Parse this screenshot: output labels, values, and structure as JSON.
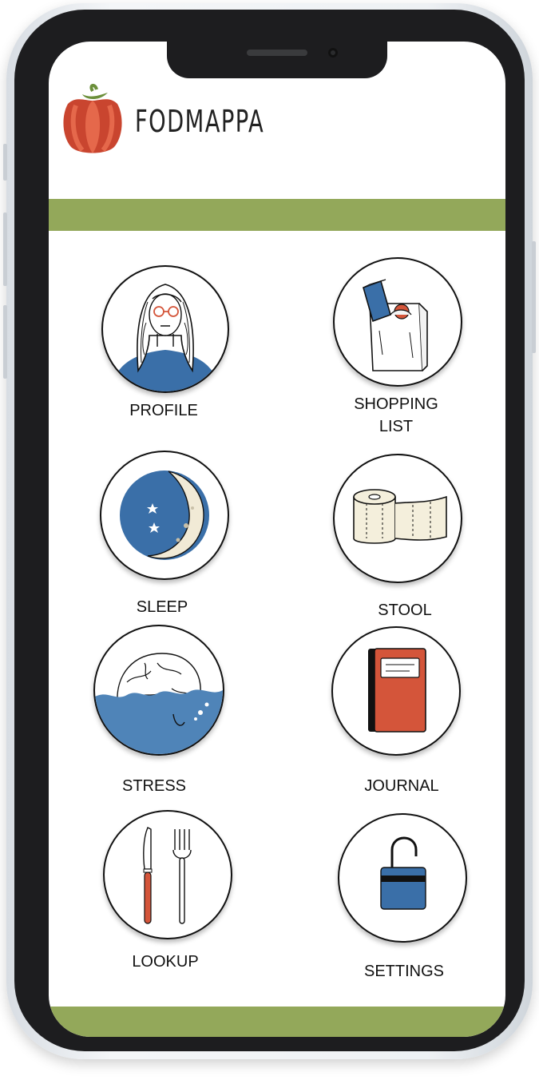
{
  "app": {
    "name": "FODMAPPA",
    "brand_color": "#93a85a",
    "accent_red": "#d4553a",
    "accent_blue": "#3a6fa8"
  },
  "menu": [
    {
      "id": "profile",
      "label": "PROFILE",
      "icon": "woman-portrait-icon"
    },
    {
      "id": "shopping",
      "label": "SHOPPING\nLIST",
      "icon": "grocery-bag-icon"
    },
    {
      "id": "sleep",
      "label": "SLEEP",
      "icon": "moon-icon"
    },
    {
      "id": "stool",
      "label": "STOOL",
      "icon": "toilet-paper-icon"
    },
    {
      "id": "stress",
      "label": "STRESS",
      "icon": "brain-underwater-icon"
    },
    {
      "id": "journal",
      "label": "JOURNAL",
      "icon": "notebook-icon"
    },
    {
      "id": "lookup",
      "label": "LOOKUP",
      "icon": "knife-fork-icon"
    },
    {
      "id": "settings",
      "label": "SETTINGS",
      "icon": "padlock-icon"
    }
  ]
}
